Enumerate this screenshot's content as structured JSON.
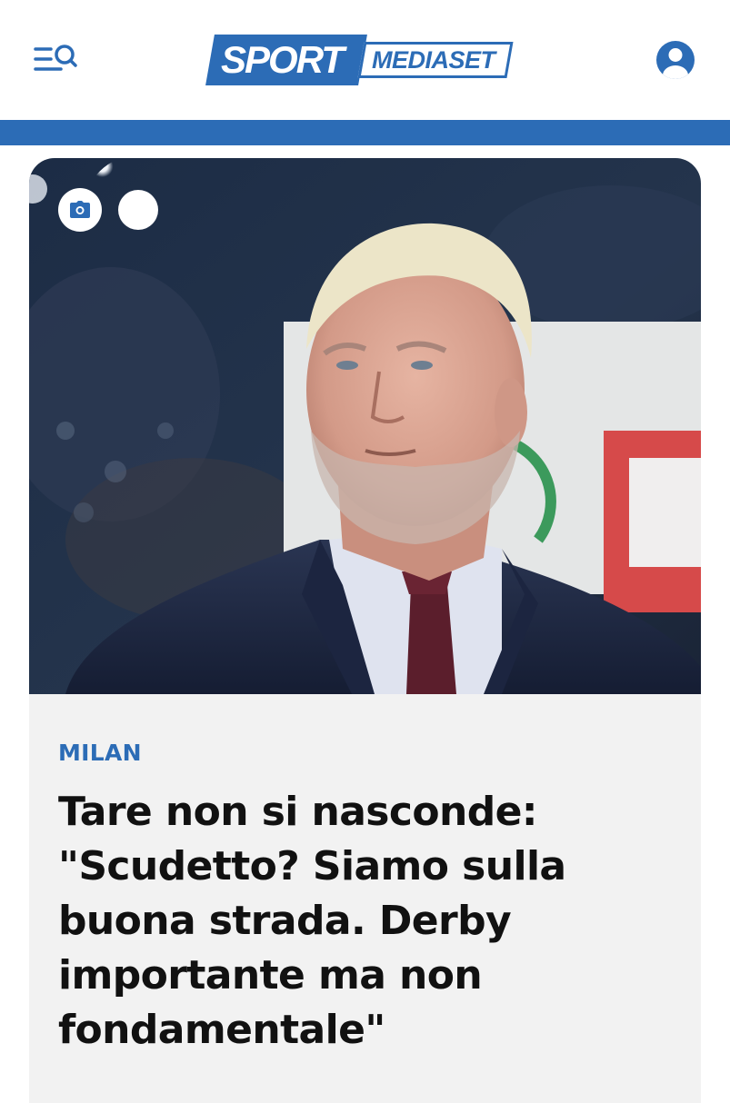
{
  "header": {
    "menu_icon": "menu-search-icon",
    "logo": {
      "sport": "SPORT",
      "mediaset": "MEDIASET"
    },
    "user_icon": "user-account-icon"
  },
  "article": {
    "photo_icon": "camera-icon",
    "category": "MILAN",
    "headline": "Tare non si nasconde: \"Scudetto? Siamo sulla buona strada. Derby importante ma non fondamentale\""
  },
  "colors": {
    "brand_blue": "#2c6cb6",
    "card_background": "#f2f2f2",
    "headline_text": "#111111"
  }
}
